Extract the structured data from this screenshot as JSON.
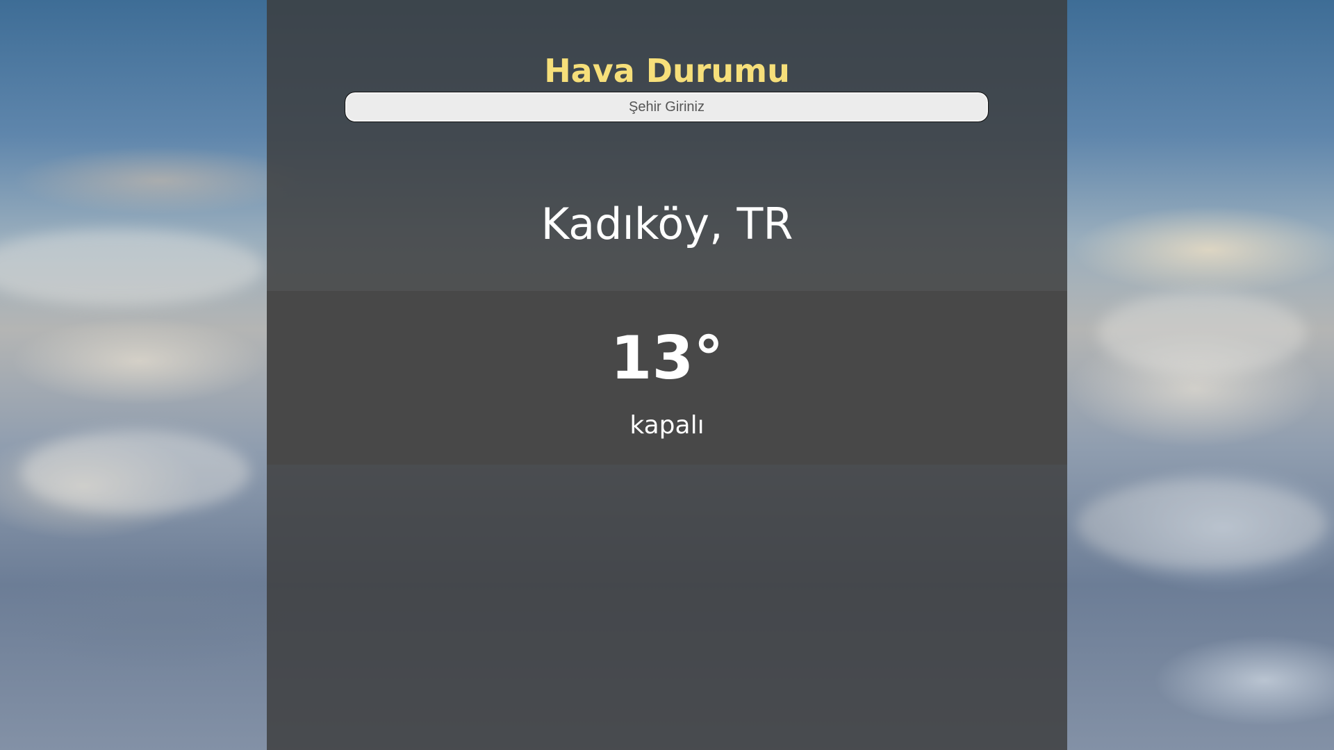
{
  "app": {
    "title": "Hava Durumu"
  },
  "search": {
    "placeholder": "Şehir Giriniz",
    "value": ""
  },
  "weather": {
    "location": "Kadıköy, TR",
    "temperature": "13°",
    "description": "kapalı"
  },
  "colors": {
    "title": "#f6df7a",
    "text": "#ffffff",
    "panel": "#3c3c3c",
    "input_background": "#ececec"
  },
  "icons": []
}
